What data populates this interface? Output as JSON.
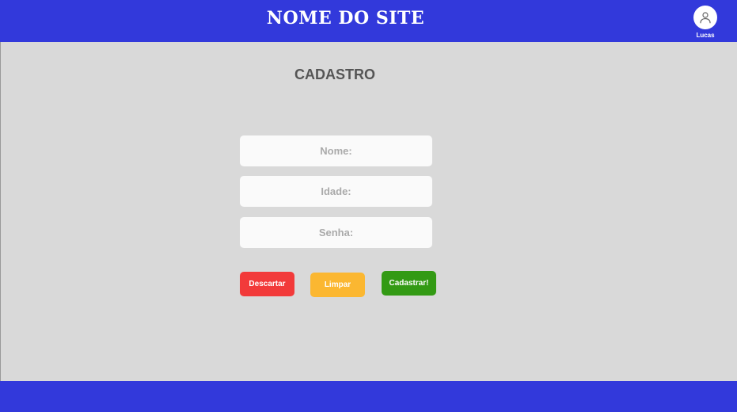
{
  "header": {
    "site_title": "NOME DO SITE",
    "user": {
      "name": "Lucas",
      "icon": "user-icon"
    }
  },
  "form": {
    "title": "CADASTRO",
    "fields": {
      "nome": {
        "placeholder": "Nome:",
        "value": ""
      },
      "idade": {
        "placeholder": "Idade:",
        "value": ""
      },
      "senha": {
        "placeholder": "Senha:",
        "value": ""
      }
    },
    "buttons": {
      "discard": {
        "label": "Descartar",
        "color": "#f23a3a"
      },
      "clear": {
        "label": "Limpar",
        "color": "#fbb731"
      },
      "submit": {
        "label": "Cadastrar!",
        "color": "#339a14"
      }
    }
  },
  "colors": {
    "brand": "#3239db",
    "background": "#d9d9d9"
  }
}
